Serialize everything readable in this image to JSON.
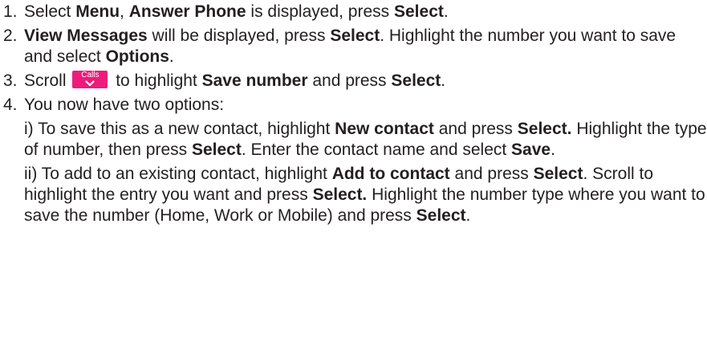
{
  "steps": [
    {
      "num": "1.",
      "t1": "Select ",
      "b1": "Menu",
      "t2": ", ",
      "b2": "Answer Phone",
      "t3": " is displayed, press ",
      "b3": "Select",
      "t4": "."
    },
    {
      "num": "2.",
      "b1": "View Messages",
      "t1": " will be displayed, press ",
      "b2": "Select",
      "t2": ". Highlight the number you want to save and select ",
      "b3": "Options",
      "t3": "."
    },
    {
      "num": "3.",
      "t1": "Scroll ",
      "key_label": "Calls",
      "key_icon": "chevron-down-icon",
      "t2": " to highlight ",
      "b1": "Save number",
      "t3": " and press ",
      "b2": "Select",
      "t4": "."
    },
    {
      "num": "4.",
      "intro": "You now have two options:",
      "opt1": {
        "t1": "i) To save this as a new contact, highlight ",
        "b1": "New contact",
        "t2": " and press ",
        "b2": "Select.",
        "t3": " Highlight the type of number, then press ",
        "b3": "Select",
        "t4": ". Enter the contact name and select ",
        "b4": "Save",
        "t5": "."
      },
      "opt2": {
        "t1": "ii) To add to an existing contact, highlight ",
        "b1": "Add to contact",
        "t2": " and press ",
        "b2": "Select",
        "t3": ". Scroll to highlight the entry you want and press ",
        "b3": "Select.",
        "t4": " Highlight the number type where you want to save the number (Home, Work or Mobile) and press ",
        "b4": "Select",
        "t5": "."
      }
    }
  ],
  "colors": {
    "text": "#231f20",
    "key_background": "#ed1c7b",
    "key_text": "#ffffff"
  }
}
